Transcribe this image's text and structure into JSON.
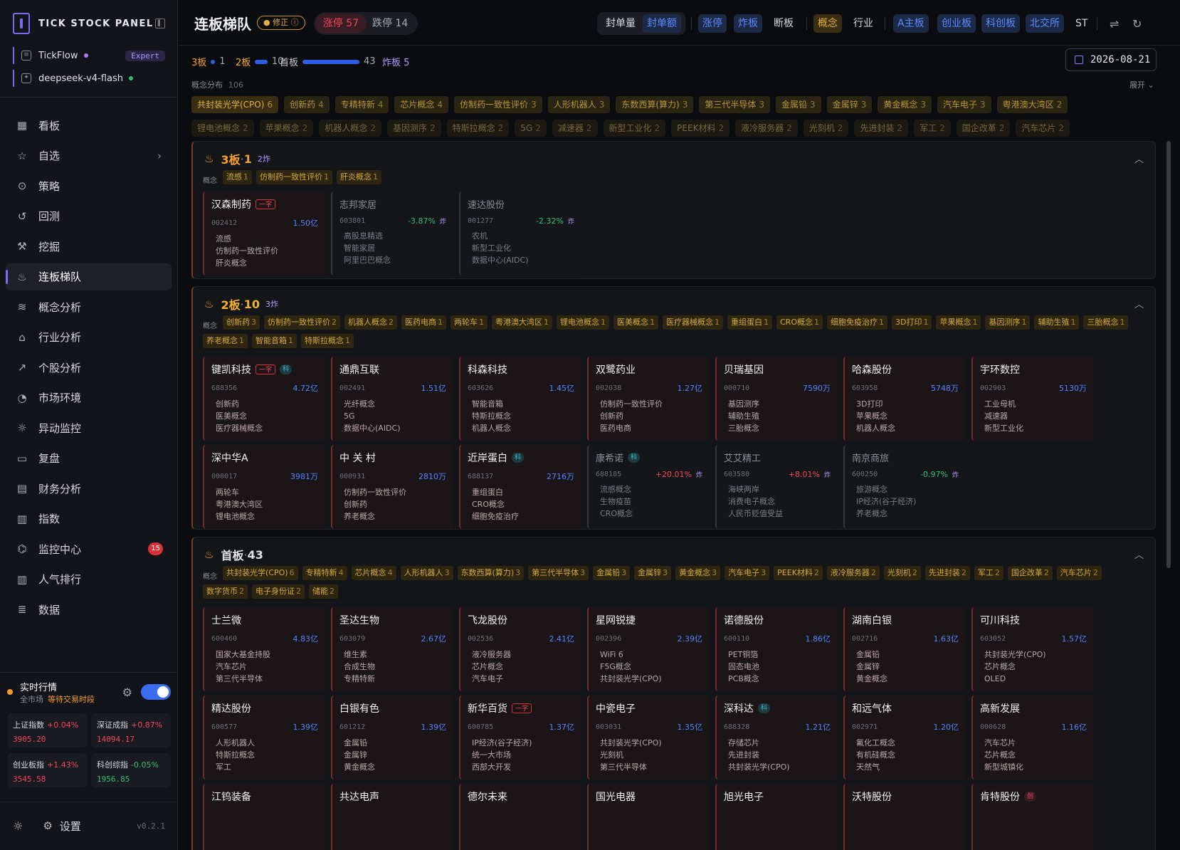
{
  "app": {
    "name": "TICK STOCK PANEL",
    "accounts": [
      {
        "name": "TickFlow",
        "tag": "Expert",
        "dot": "#a47cff"
      },
      {
        "name": "deepseek-v4-flash",
        "dot": "#2fc074"
      }
    ]
  },
  "nav": [
    {
      "label": "看板",
      "icon": "grid-icon",
      "glyph": "▦"
    },
    {
      "label": "自选",
      "icon": "star-icon",
      "glyph": "☆",
      "chevron": true
    },
    {
      "label": "策略",
      "icon": "target-icon",
      "glyph": "⊙"
    },
    {
      "label": "回测",
      "icon": "history-icon",
      "glyph": "↺"
    },
    {
      "label": "挖掘",
      "icon": "pick-icon",
      "glyph": "⚒"
    },
    {
      "label": "连板梯队",
      "icon": "flame-icon",
      "glyph": "♨",
      "active": true
    },
    {
      "label": "概念分析",
      "icon": "layers-icon",
      "glyph": "≋"
    },
    {
      "label": "行业分析",
      "icon": "bank-icon",
      "glyph": "⌂"
    },
    {
      "label": "个股分析",
      "icon": "trend-icon",
      "glyph": "↗"
    },
    {
      "label": "市场环境",
      "icon": "gauge-icon",
      "glyph": "◔"
    },
    {
      "label": "异动监控",
      "icon": "alert-icon",
      "glyph": "☼"
    },
    {
      "label": "复盘",
      "icon": "review-icon",
      "glyph": "▭"
    },
    {
      "label": "财务分析",
      "icon": "doc-icon",
      "glyph": "▤"
    },
    {
      "label": "指数",
      "icon": "bars-icon",
      "glyph": "▥"
    },
    {
      "label": "监控中心",
      "icon": "radio-icon",
      "glyph": "⌬",
      "badge": "15"
    },
    {
      "label": "人气排行",
      "icon": "rank-icon",
      "glyph": "▥"
    },
    {
      "label": "数据",
      "icon": "database-icon",
      "glyph": "≣"
    }
  ],
  "realtime": {
    "title": "实时行情",
    "scope": "全市场",
    "status": "等待交易时段"
  },
  "indices": [
    {
      "name": "上证指数",
      "chg": "+0.04%",
      "val": "3905.20",
      "dir": "up"
    },
    {
      "name": "深证成指",
      "chg": "+0.87%",
      "val": "14094.17",
      "dir": "up"
    },
    {
      "name": "创业板指",
      "chg": "+1.43%",
      "val": "3545.58",
      "dir": "up"
    },
    {
      "name": "科创综指",
      "chg": "-0.05%",
      "val": "1956.85",
      "dir": "dn"
    }
  ],
  "footer": {
    "settings": "设置",
    "version": "v0.2.1"
  },
  "header": {
    "title": "连板梯队",
    "fix": "修正",
    "up_limit": "涨停 57",
    "down_limit": "跌停 14",
    "sort": [
      "封单量",
      "封单额"
    ],
    "types": [
      "涨停",
      "炸板",
      "断板"
    ],
    "dims": [
      "概念",
      "行业"
    ],
    "boards": [
      "A主板",
      "创业板",
      "科创板",
      "北交所"
    ],
    "st": "ST"
  },
  "levels": [
    {
      "label": "3板",
      "count": "1",
      "bar": 0.04
    },
    {
      "label": "2板",
      "count": "10",
      "bar": 0.22
    },
    {
      "label": "首板",
      "count": "43",
      "bar": 1
    }
  ],
  "zhaban": "炸板 5",
  "date": "2026-08-21",
  "concept_dist": {
    "label": "概念分布",
    "count": "106",
    "expand": "展开"
  },
  "concept_rows": [
    [
      {
        "n": "共封装光学(CPO)",
        "c": "6",
        "s": "hi"
      },
      {
        "n": "创新药",
        "c": "4",
        "s": "lo"
      },
      {
        "n": "专精特新",
        "c": "4",
        "s": "lo"
      },
      {
        "n": "芯片概念",
        "c": "4",
        "s": "lo"
      },
      {
        "n": "仿制药一致性评价",
        "c": "3",
        "s": "lo"
      },
      {
        "n": "人形机器人",
        "c": "3",
        "s": "lo"
      },
      {
        "n": "东数西算(算力)",
        "c": "3",
        "s": "lo"
      },
      {
        "n": "第三代半导体",
        "c": "3",
        "s": "lo"
      },
      {
        "n": "金属铅",
        "c": "3",
        "s": "lo"
      },
      {
        "n": "金属锌",
        "c": "3",
        "s": "lo"
      },
      {
        "n": "黄金概念",
        "c": "3",
        "s": "lo"
      },
      {
        "n": "汽车电子",
        "c": "3",
        "s": "lo"
      },
      {
        "n": "粤港澳大湾区",
        "c": "2",
        "s": "lo"
      }
    ],
    [
      {
        "n": "锂电池概念",
        "c": "2",
        "s": "dim"
      },
      {
        "n": "苹果概念",
        "c": "2",
        "s": "dim"
      },
      {
        "n": "机器人概念",
        "c": "2",
        "s": "dim"
      },
      {
        "n": "基因测序",
        "c": "2",
        "s": "dim"
      },
      {
        "n": "特斯拉概念",
        "c": "2",
        "s": "dim"
      },
      {
        "n": "5G",
        "c": "2",
        "s": "dim"
      },
      {
        "n": "减速器",
        "c": "2",
        "s": "dim"
      },
      {
        "n": "新型工业化",
        "c": "2",
        "s": "dim"
      },
      {
        "n": "PEEK材料",
        "c": "2",
        "s": "dim"
      },
      {
        "n": "液冷服务器",
        "c": "2",
        "s": "dim"
      },
      {
        "n": "光刻机",
        "c": "2",
        "s": "dim"
      },
      {
        "n": "先进封装",
        "c": "2",
        "s": "dim"
      },
      {
        "n": "军工",
        "c": "2",
        "s": "dim"
      },
      {
        "n": "国企改革",
        "c": "2",
        "s": "dim"
      },
      {
        "n": "汽车芯片",
        "c": "2",
        "s": "dim"
      }
    ]
  ],
  "panels": [
    {
      "name": "3板",
      "count": "1",
      "zb": "2炸",
      "color": "#f59f2a",
      "concept_label": "概念",
      "concepts": [
        [
          "流感",
          "1"
        ],
        [
          "仿制药一致性评价",
          "1"
        ],
        [
          "肝炎概念",
          "1"
        ]
      ],
      "cards": [
        {
          "name": "汉森制药",
          "badge": "一字",
          "badge_t": "yz",
          "code": "002412",
          "amt": "1.50亿",
          "tags": [
            "流感",
            "仿制药一致性评价",
            "肝炎概念"
          ]
        },
        {
          "name": "志邦家居",
          "fz": true,
          "code": "603801",
          "pct": "-3.87%",
          "dir": "dn",
          "zb": "炸",
          "tags": [
            "高股息精选",
            "智能家居",
            "阿里巴巴概念"
          ]
        },
        {
          "name": "速达股份",
          "fz": true,
          "code": "001277",
          "pct": "-2.32%",
          "dir": "dn",
          "zb": "炸",
          "tags": [
            "农机",
            "新型工业化",
            "数据中心(AIDC)"
          ]
        }
      ]
    },
    {
      "name": "2板",
      "count": "10",
      "zb": "3炸",
      "color": "#f5b12a",
      "concept_label": "概念",
      "concepts": [
        [
          "创新药",
          "3"
        ],
        [
          "仿制药一致性评价",
          "2"
        ],
        [
          "机器人概念",
          "2"
        ],
        [
          "医药电商",
          "1"
        ],
        [
          "两轮车",
          "1"
        ],
        [
          "粤港澳大湾区",
          "1"
        ],
        [
          "锂电池概念",
          "1"
        ],
        [
          "医美概念",
          "1"
        ],
        [
          "医疗器械概念",
          "1"
        ],
        [
          "重组蛋白",
          "1"
        ],
        [
          "CRO概念",
          "1"
        ],
        [
          "细胞免疫治疗",
          "1"
        ],
        [
          "3D打印",
          "1"
        ],
        [
          "苹果概念",
          "1"
        ],
        [
          "基因测序",
          "1"
        ],
        [
          "辅助生殖",
          "1"
        ],
        [
          "三胎概念",
          "1"
        ],
        [
          "养老概念",
          "1"
        ],
        [
          "智能音箱",
          "1"
        ],
        [
          "特斯拉概念",
          "1"
        ]
      ],
      "cards": [
        {
          "name": "键凯科技",
          "badge": "一字",
          "badge_t": "yz",
          "badge2": "科",
          "code": "688356",
          "amt": "4.72亿",
          "tags": [
            "创新药",
            "医美概念",
            "医疗器械概念"
          ]
        },
        {
          "name": "通鼎互联",
          "code": "002491",
          "amt": "1.51亿",
          "tags": [
            "光纤概念",
            "5G",
            "数据中心(AIDC)"
          ]
        },
        {
          "name": "科森科技",
          "code": "603626",
          "amt": "1.45亿",
          "tags": [
            "智能音箱",
            "特斯拉概念",
            "机器人概念"
          ]
        },
        {
          "name": "双鹭药业",
          "code": "002038",
          "amt": "1.27亿",
          "tags": [
            "仿制药一致性评价",
            "创新药",
            "医药电商"
          ]
        },
        {
          "name": "贝瑞基因",
          "code": "000710",
          "amt": "7590万",
          "tags": [
            "基因测序",
            "辅助生殖",
            "三胎概念"
          ]
        },
        {
          "name": "哈森股份",
          "code": "603958",
          "amt": "5748万",
          "tags": [
            "3D打印",
            "苹果概念",
            "机器人概念"
          ]
        },
        {
          "name": "宇环数控",
          "code": "002903",
          "amt": "5130万",
          "tags": [
            "工业母机",
            "减速器",
            "新型工业化"
          ]
        },
        {
          "name": "深中华A",
          "code": "000017",
          "amt": "3981万",
          "tags": [
            "两轮车",
            "粤港澳大湾区",
            "锂电池概念"
          ]
        },
        {
          "name": "中 关 村",
          "code": "000931",
          "amt": "2810万",
          "tags": [
            "仿制药一致性评价",
            "创新药",
            "养老概念"
          ]
        },
        {
          "name": "近岸蛋白",
          "badge2": "科",
          "code": "688137",
          "amt": "2716万",
          "tags": [
            "重组蛋白",
            "CRO概念",
            "细胞免疫治疗"
          ]
        },
        {
          "name": "康希诺",
          "fz": true,
          "badge2": "科",
          "code": "688185",
          "pct": "+20.01%",
          "dir": "up",
          "zb": "炸",
          "tags": [
            "流感概念",
            "生物疫苗",
            "CRO概念"
          ]
        },
        {
          "name": "艾艾精工",
          "fz": true,
          "code": "603580",
          "pct": "+8.01%",
          "dir": "up",
          "zb": "炸",
          "tags": [
            "海峡两岸",
            "消费电子概念",
            "人民币贬值受益"
          ]
        },
        {
          "name": "南京商旅",
          "fz": true,
          "code": "600250",
          "pct": "-0.97%",
          "dir": "dn",
          "zb": "炸",
          "tags": [
            "旅游概念",
            "IP经济(谷子经济)",
            "养老概念"
          ]
        }
      ]
    },
    {
      "name": "首板",
      "count": "43",
      "zb": "",
      "color": "#e0e1e6",
      "concept_label": "概念",
      "concepts": [
        [
          "共封装光学(CPO)",
          "6"
        ],
        [
          "专精特新",
          "4"
        ],
        [
          "芯片概念",
          "4"
        ],
        [
          "人形机器人",
          "3"
        ],
        [
          "东数西算(算力)",
          "3"
        ],
        [
          "第三代半导体",
          "3"
        ],
        [
          "金属铅",
          "3"
        ],
        [
          "金属锌",
          "3"
        ],
        [
          "黄金概念",
          "3"
        ],
        [
          "汽车电子",
          "3"
        ],
        [
          "PEEK材料",
          "2"
        ],
        [
          "液冷服务器",
          "2"
        ],
        [
          "光刻机",
          "2"
        ],
        [
          "先进封装",
          "2"
        ],
        [
          "军工",
          "2"
        ],
        [
          "国企改革",
          "2"
        ],
        [
          "汽车芯片",
          "2"
        ],
        [
          "数字货币",
          "2"
        ],
        [
          "电子身份证",
          "2"
        ],
        [
          "储能",
          "2"
        ]
      ],
      "cards": [
        {
          "name": "士兰微",
          "code": "600460",
          "amt": "4.83亿",
          "tags": [
            "国家大基金持股",
            "汽车芯片",
            "第三代半导体"
          ]
        },
        {
          "name": "圣达生物",
          "code": "603079",
          "amt": "2.67亿",
          "tags": [
            "维生素",
            "合成生物",
            "专精特新"
          ]
        },
        {
          "name": "飞龙股份",
          "code": "002536",
          "amt": "2.41亿",
          "tags": [
            "液冷服务器",
            "芯片概念",
            "汽车电子"
          ]
        },
        {
          "name": "星网锐捷",
          "code": "002396",
          "amt": "2.39亿",
          "tags": [
            "WiFi 6",
            "F5G概念",
            "共封装光学(CPO)"
          ]
        },
        {
          "name": "诺德股份",
          "code": "600110",
          "amt": "1.86亿",
          "tags": [
            "PET铜箔",
            "固态电池",
            "PCB概念"
          ]
        },
        {
          "name": "湖南白银",
          "code": "002716",
          "amt": "1.63亿",
          "tags": [
            "金属铅",
            "金属锌",
            "黄金概念"
          ]
        },
        {
          "name": "可川科技",
          "code": "603052",
          "amt": "1.57亿",
          "tags": [
            "共封装光学(CPO)",
            "芯片概念",
            "OLED"
          ]
        },
        {
          "name": "精达股份",
          "code": "600577",
          "amt": "1.39亿",
          "tags": [
            "人形机器人",
            "特斯拉概念",
            "军工"
          ]
        },
        {
          "name": "白银有色",
          "code": "601212",
          "amt": "1.39亿",
          "tags": [
            "金属铅",
            "金属锌",
            "黄金概念"
          ]
        },
        {
          "name": "新华百货",
          "badge": "一字",
          "badge_t": "yz",
          "code": "600785",
          "amt": "1.37亿",
          "tags": [
            "IP经济(谷子经济)",
            "统一大市场",
            "西部大开发"
          ]
        },
        {
          "name": "中瓷电子",
          "code": "003031",
          "amt": "1.35亿",
          "tags": [
            "共封装光学(CPO)",
            "光刻机",
            "第三代半导体"
          ]
        },
        {
          "name": "深科达",
          "badge2": "科",
          "code": "688328",
          "amt": "1.21亿",
          "tags": [
            "存储芯片",
            "先进封装",
            "共封装光学(CPO)"
          ]
        },
        {
          "name": "和远气体",
          "code": "002971",
          "amt": "1.20亿",
          "tags": [
            "氟化工概念",
            "有机硅概念",
            "天然气"
          ]
        },
        {
          "name": "高新发展",
          "code": "000628",
          "amt": "1.16亿",
          "tags": [
            "汽车芯片",
            "芯片概念",
            "新型城镇化"
          ]
        },
        {
          "name": "江钨装备",
          "code": "",
          "amt": "",
          "tags": []
        },
        {
          "name": "共达电声",
          "code": "",
          "amt": "",
          "tags": []
        },
        {
          "name": "德尔未来",
          "code": "",
          "amt": "",
          "tags": []
        },
        {
          "name": "国光电器",
          "code": "",
          "amt": "",
          "tags": []
        },
        {
          "name": "旭光电子",
          "code": "",
          "amt": "",
          "tags": []
        },
        {
          "name": "沃特股份",
          "code": "",
          "amt": "",
          "tags": []
        },
        {
          "name": "肯特股份",
          "badge3": "创",
          "code": "",
          "amt": "",
          "tags": []
        }
      ]
    }
  ]
}
